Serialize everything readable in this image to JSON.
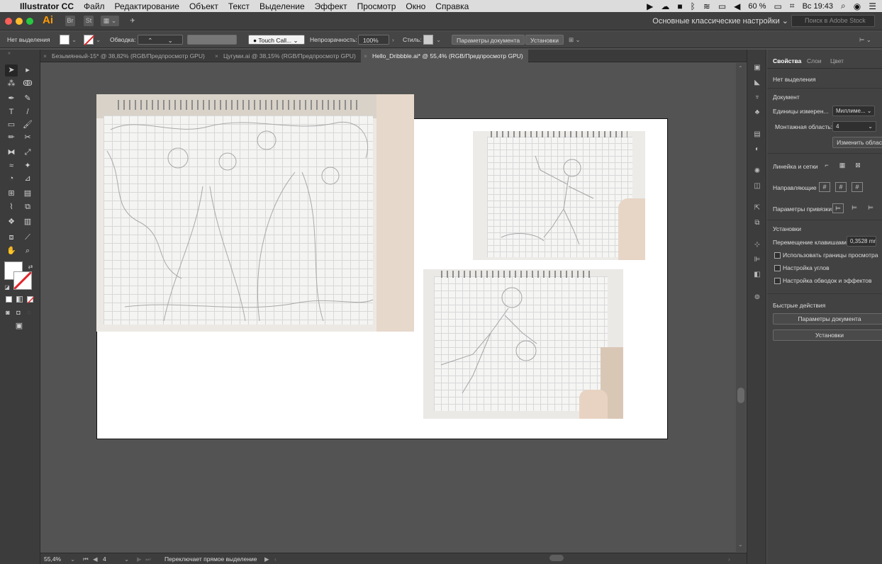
{
  "menubar": {
    "app_name": "Illustrator CC",
    "items": [
      "Файл",
      "Редактирование",
      "Объект",
      "Текст",
      "Выделение",
      "Эффект",
      "Просмотр",
      "Окно",
      "Справка"
    ],
    "battery": "60 %",
    "clock": "Вс 19:43"
  },
  "titlebar": {
    "logo": "Ai",
    "workspace": "Основные классические настройки",
    "stock_search_placeholder": "Поиск в Adobe Stock"
  },
  "controlbar": {
    "selection_state": "Нет выделения",
    "stroke_label": "Обводка:",
    "brush_name": "Touch Call...",
    "opacity_label": "Непрозрачность:",
    "opacity_value": "100%",
    "style_label": "Стиль:",
    "doc_settings_button": "Параметры документа",
    "preferences_button": "Установки"
  },
  "tabs": [
    {
      "label": "Безымянный-15* @ 38,82% (RGB/Предпросмотр GPU)",
      "active": false
    },
    {
      "label": "Цугуми.ai @ 38,15% (RGB/Предпросмотр GPU)",
      "active": false
    },
    {
      "label": "Hello_Dribbble.ai* @ 55,4% (RGB/Предпросмотр GPU)",
      "active": true
    }
  ],
  "properties": {
    "tabs": [
      "Свойства",
      "Слои",
      "Цвет"
    ],
    "no_selection": "Нет выделения",
    "document_heading": "Документ",
    "units_label": "Единицы измерен...",
    "units_value": "Миллиме...",
    "artboard_label": "Монтажная область:",
    "artboard_value": "4",
    "edit_artboards_button": "Изменить област",
    "rulers_grids_label": "Линейка и сетки",
    "guides_label": "Направляющие",
    "snap_label": "Параметры привязки",
    "preferences_heading": "Установки",
    "keyboard_increment_label": "Перемещение клавишами:",
    "keyboard_increment_value": "0,3528 mr",
    "checkboxes": [
      "Использовать границы просмотра",
      "Настройка углов",
      "Настройка обводок и эффектов"
    ],
    "quick_actions_heading": "Быстрые действия",
    "quick_doc_settings_button": "Параметры документа",
    "quick_preferences_button": "Установки"
  },
  "statusbar": {
    "zoom": "55,4%",
    "artboard_number": "4",
    "hint": "Переключает прямое выделение"
  },
  "colors": {
    "accent_logo": "#ff9a00",
    "stroke_none": "#e0262b"
  }
}
